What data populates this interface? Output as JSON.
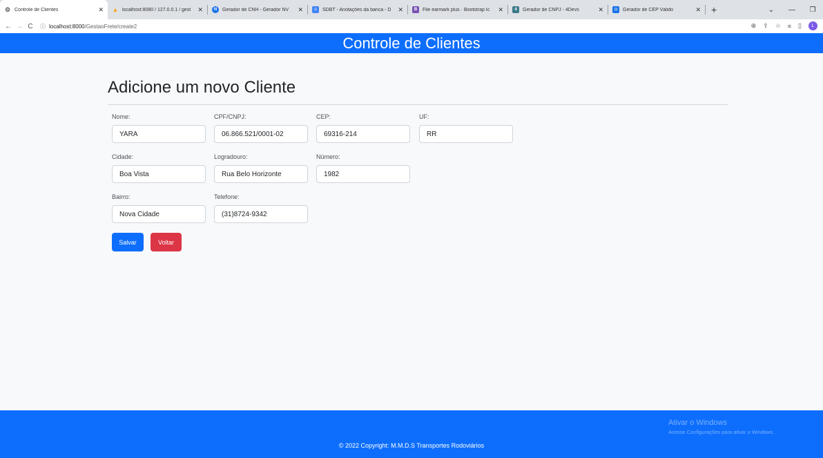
{
  "browser": {
    "tabs": [
      {
        "label": "Controle de Clientes",
        "favicon_color": "#5f6368",
        "favicon_char": "⚙",
        "active": true
      },
      {
        "label": "localhost:8080 / 127.0.0.1 / gest",
        "favicon_color": "#f5a623",
        "favicon_char": "▲",
        "active": false
      },
      {
        "label": "Gerador de CNH - Gerador NV",
        "favicon_color": "#1a73e8",
        "favicon_char": "N",
        "active": false
      },
      {
        "label": "SDBT - Anotações da banca - D",
        "favicon_color": "#4285f4",
        "favicon_char": "≡",
        "active": false
      },
      {
        "label": "File earmark plus · Bootstrap Ic",
        "favicon_color": "#7952b3",
        "favicon_char": "B",
        "active": false
      },
      {
        "label": "Gerador de CNPJ - 4Devs",
        "favicon_color": "#3c7a89",
        "favicon_char": "4",
        "active": false
      },
      {
        "label": "Gerador de CEP Válido",
        "favicon_color": "#1a73e8",
        "favicon_char": "◘",
        "active": false
      }
    ],
    "new_tab": "+",
    "url_host": "localhost:8000",
    "url_path": "/GestaoFrete/create2",
    "profile_initial": "L"
  },
  "navbar": {
    "title": "Controle de Clientes"
  },
  "page": {
    "heading": "Adicione um novo Cliente"
  },
  "form": {
    "nome": {
      "label": "Nome:",
      "value": "YARA"
    },
    "cpf": {
      "label": "CPF/CNPJ:",
      "value": "06.866.521/0001-02"
    },
    "cep": {
      "label": "CEP:",
      "value": "69316-214"
    },
    "uf": {
      "label": "UF:",
      "value": "RR"
    },
    "cidade": {
      "label": "Cidade:",
      "value": "Boa Vista"
    },
    "logradouro": {
      "label": "Logradouro:",
      "value": "Rua Belo Horizonte"
    },
    "numero": {
      "label": "Número:",
      "value": "1982"
    },
    "bairro": {
      "label": "Bairro:",
      "value": "Nova Cidade"
    },
    "telefone": {
      "label": "Telefone:",
      "value": "(31)8724-9342"
    }
  },
  "buttons": {
    "save": "Salvar",
    "back": "Voltar"
  },
  "footer": {
    "copyright": "© 2022 Copyright: M.M.D.S Transportes Rodoviários"
  },
  "watermark": {
    "title": "Ativar o Windows",
    "subtitle": "Acesse Configurações para ativar o Windows."
  },
  "colors": {
    "primary": "#0d6efd",
    "danger": "#dc3545"
  }
}
